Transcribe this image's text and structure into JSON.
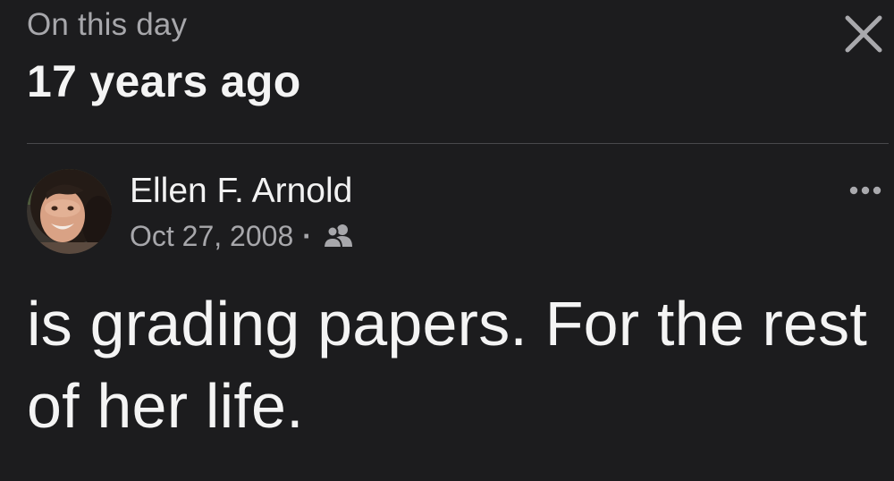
{
  "header": {
    "subtitle": "On this day",
    "title": "17 years ago"
  },
  "post": {
    "author": "Ellen F. Arnold",
    "date": "Oct 27, 2008",
    "separator": "·",
    "text": "is grading papers. For the rest of her life."
  },
  "icons": {
    "close": "close-icon",
    "more": "more-horizontal-icon",
    "audience": "friends-icon"
  },
  "colors": {
    "background": "#1c1c1e",
    "primary_text": "#f2f2f2",
    "secondary_text": "#a7a7ab",
    "divider": "#48484c"
  }
}
